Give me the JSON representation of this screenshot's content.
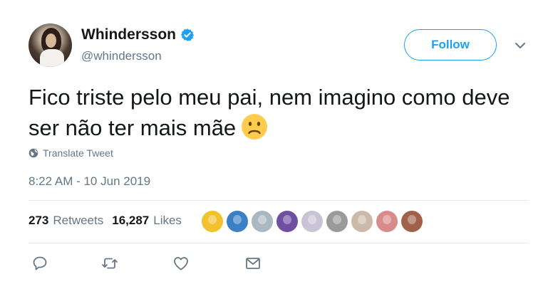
{
  "user": {
    "display_name": "Whindersson",
    "handle": "@whindersson",
    "verified": true
  },
  "header": {
    "follow_label": "Follow"
  },
  "tweet": {
    "text": "Fico triste pelo meu pai, nem imagino como deve ser não ter mais mãe",
    "emoji": "frowning-face-emoji",
    "translate_label": "Translate Tweet",
    "timestamp": "8:22 AM - 10 Jun 2019"
  },
  "stats": {
    "retweets_count": "273",
    "retweets_label": "Retweets",
    "likes_count": "16,287",
    "likes_label": "Likes"
  },
  "likers": [
    {
      "color": "#f2c12e"
    },
    {
      "color": "#3b7fc4"
    },
    {
      "color": "#aab8c2"
    },
    {
      "color": "#6e4fa0"
    },
    {
      "color": "#c9c3d6"
    },
    {
      "color": "#9a9a9a"
    },
    {
      "color": "#cdb9a8"
    },
    {
      "color": "#d98a8a"
    },
    {
      "color": "#a0624a"
    }
  ],
  "actions": [
    "reply-icon",
    "retweet-icon",
    "like-icon",
    "direct-message-icon"
  ],
  "colors": {
    "accent": "#1da1f2",
    "secondary_text": "#657786",
    "divider": "#e6ecf0"
  }
}
